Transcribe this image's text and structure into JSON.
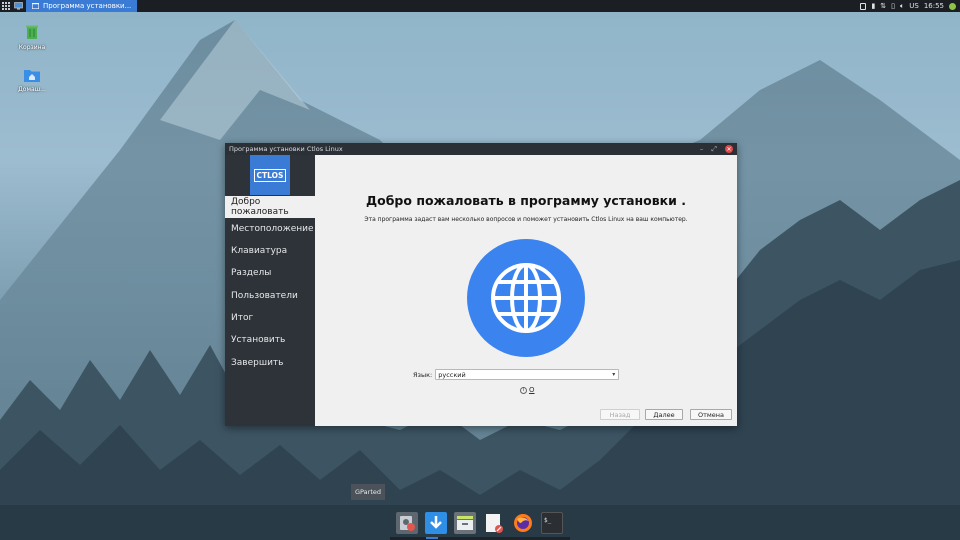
{
  "top_panel": {
    "task_title": "Программа установки...",
    "keyboard_layout": "US",
    "clock": "16:55"
  },
  "desktop_icons": [
    {
      "label": "Корзина",
      "icon": "trash-icon"
    },
    {
      "label": "Домаш...",
      "icon": "home-folder-icon"
    }
  ],
  "window": {
    "title": "Программа установки Ctlos Linux",
    "logo_text": "CTLOS",
    "steps": [
      {
        "label": "Добро пожаловать",
        "active": true
      },
      {
        "label": "Местоположение"
      },
      {
        "label": "Клавиатура"
      },
      {
        "label": "Разделы"
      },
      {
        "label": "Пользователи"
      },
      {
        "label": "Итог"
      },
      {
        "label": "Установить"
      },
      {
        "label": "Завершить"
      }
    ],
    "welcome_heading": "Добро пожаловать в программу установки .",
    "welcome_text": "Эта программа задаст вам несколько вопросов и поможет установить Ctlos Linux на ваш компьютер.",
    "language_label": "Язык:",
    "language_value": "русский",
    "about_label": "О",
    "buttons": {
      "back": "Назад",
      "next": "Далее",
      "cancel": "Отмена"
    }
  },
  "dock": {
    "tooltip": "GParted",
    "items": [
      "gparted-icon",
      "installer-download-icon",
      "file-manager-icon",
      "text-editor-icon",
      "firefox-icon",
      "terminal-icon"
    ]
  },
  "colors": {
    "accent": "#3a7bd5",
    "globe": "#3b84f0",
    "sidebar": "#2e3339",
    "close": "#e04a4a"
  }
}
